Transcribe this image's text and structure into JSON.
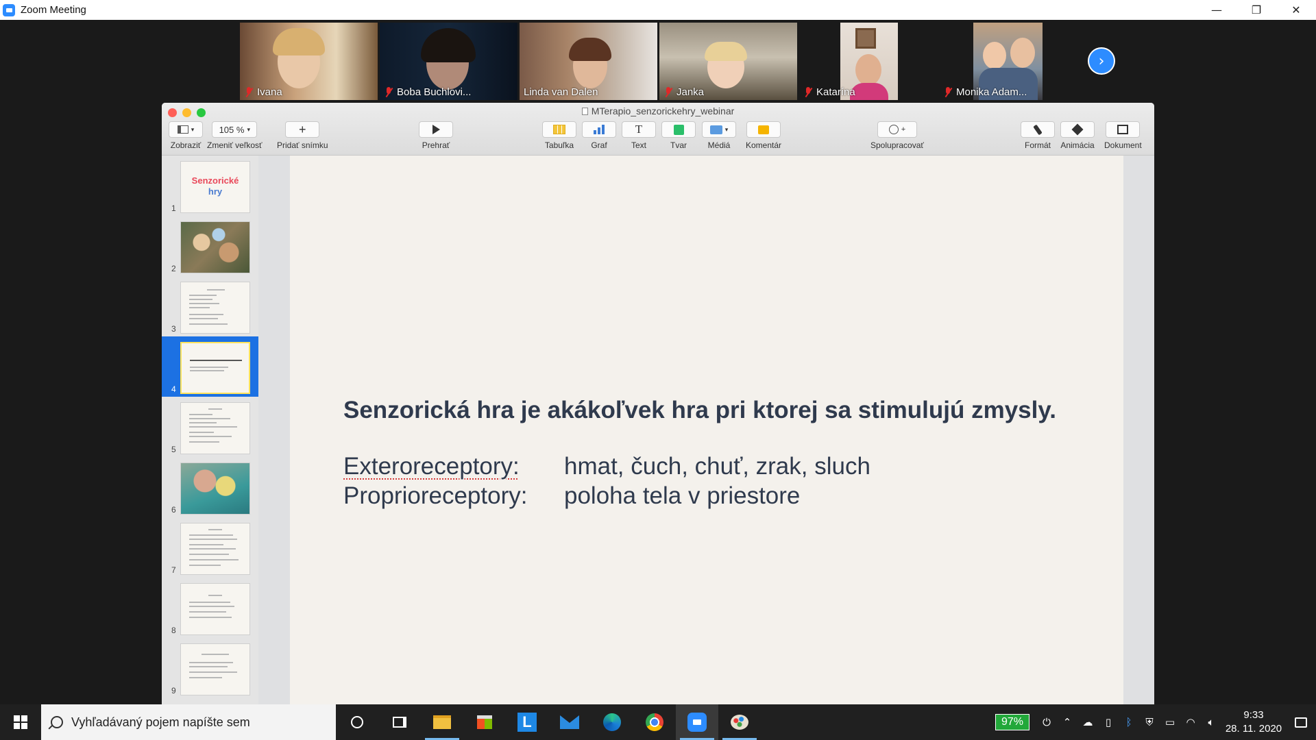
{
  "window": {
    "title": "Zoom Meeting",
    "minimize": "—",
    "maximize": "❐",
    "close": "✕"
  },
  "participants": [
    {
      "name": "Ivana",
      "muted": true
    },
    {
      "name": "Boba Buchlovi...",
      "muted": true
    },
    {
      "name": "Linda van Dalen",
      "muted": false,
      "active": true
    },
    {
      "name": "Janka",
      "muted": true
    },
    {
      "name": "Katarína",
      "muted": true
    },
    {
      "name": "Monika Adam...",
      "muted": true
    }
  ],
  "gallery_next_icon": "chevron-right-icon",
  "keynote": {
    "doc_title": "MTerapio_senzorickehry_webinar",
    "toolbar": {
      "view": "Zobraziť",
      "zoom_value": "105 %",
      "zoom": "Zmeniť veľkosť",
      "add_slide": "Pridať snímku",
      "play": "Prehrať",
      "table": "Tabuľka",
      "chart": "Graf",
      "text": "Text",
      "shape": "Tvar",
      "media": "Médiá",
      "comment": "Komentár",
      "collaborate": "Spolupracovať",
      "format": "Formát",
      "animate": "Animácia",
      "document": "Dokument"
    },
    "thumbnails": [
      {
        "num": "1",
        "title_word1": "Senzorické",
        "title_word2": "hry"
      },
      {
        "num": "2"
      },
      {
        "num": "3"
      },
      {
        "num": "4",
        "selected": true
      },
      {
        "num": "5"
      },
      {
        "num": "6"
      },
      {
        "num": "7"
      },
      {
        "num": "8"
      },
      {
        "num": "9"
      }
    ],
    "selected_slide": 4,
    "slide": {
      "headline": "Senzorická hra je akákoľvek hra pri ktorej sa stimulujú zmysly.",
      "rows": [
        {
          "term": "Exteroreceptory:",
          "value": "hmat, čuch, chuť, zrak, sluch"
        },
        {
          "term": "Proprioreceptory:",
          "value": "poloha tela v priestore"
        }
      ]
    }
  },
  "taskbar": {
    "search_placeholder": "Vyhľadávaný pojem napíšte sem",
    "battery": "97%",
    "time": "9:33",
    "date": "28. 11. 2020"
  },
  "colors": {
    "zoom_blue": "#2d8cff",
    "selection_blue": "#1c71e3",
    "slide_text": "#2f3a4d",
    "muted_red": "#e02828"
  }
}
